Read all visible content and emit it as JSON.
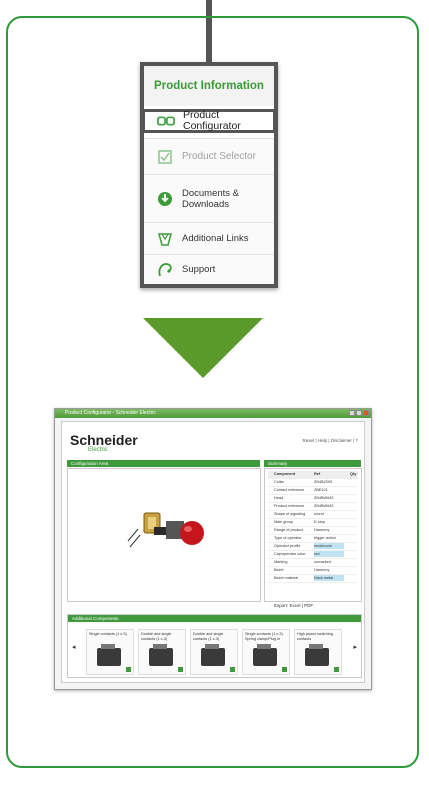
{
  "menu": {
    "header": "Product Information",
    "items": [
      {
        "label": "Product Configurator",
        "icon": "configurator-icon"
      },
      {
        "label": "Product Selector",
        "icon": "checkbox-icon"
      },
      {
        "label": "Documents & Downloads",
        "icon": "download-icon"
      },
      {
        "label": "Additional Links",
        "icon": "links-icon"
      },
      {
        "label": "Support",
        "icon": "support-icon"
      }
    ]
  },
  "colors": {
    "brand_green": "#3b9b36",
    "frame_green": "#2e9a3b",
    "arrow_green": "#5a9a2a"
  },
  "screenshot": {
    "window_title": "Product Configurator - Schneider Electric",
    "logo": "Schneider",
    "logo_sub": "Electric",
    "top_links": "Reset | Help | Disclaimer | ?",
    "config_area_title": "Configuration Area",
    "summary_title": "Summary",
    "summary_headers": [
      "Component",
      "Ref",
      "Qty"
    ],
    "summary_rows": [
      {
        "c1": "Collar",
        "c2": "ZB4BZ009"
      },
      {
        "c1": "Contact reference",
        "c2": "ZBE101"
      },
      {
        "c1": "Head",
        "c2": "ZB4BW643"
      },
      {
        "c1": "Product reference",
        "c2": "ZB4BW643"
      },
      {
        "c1": "Shape of signaling",
        "c2": "round"
      },
      {
        "c1": "Main group",
        "c2": "E-stop"
      },
      {
        "c1": "Range of product",
        "c2": "Harmony"
      },
      {
        "c1": "Type of operator",
        "c2": "trigger action"
      },
      {
        "c1": "Operator profile",
        "c2": "mushroom"
      },
      {
        "c1": "Cap/operator color",
        "c2": "red"
      },
      {
        "c1": "Marking",
        "c2": "unmarked"
      },
      {
        "c1": "Bezel",
        "c2": "Harmony"
      },
      {
        "c1": "Bezel material",
        "c2": "black metal"
      }
    ],
    "export_label": "Export: Excel | PDF",
    "additional_title": "Additional Components",
    "cards": [
      "Single contacts (1 c-3)",
      "Double and single contacts (1 c-3)",
      "Double and single contacts (1 c-3)",
      "Single contacts (1 c-3) Spring clamp/Plug in",
      "High power switching contacts"
    ]
  }
}
